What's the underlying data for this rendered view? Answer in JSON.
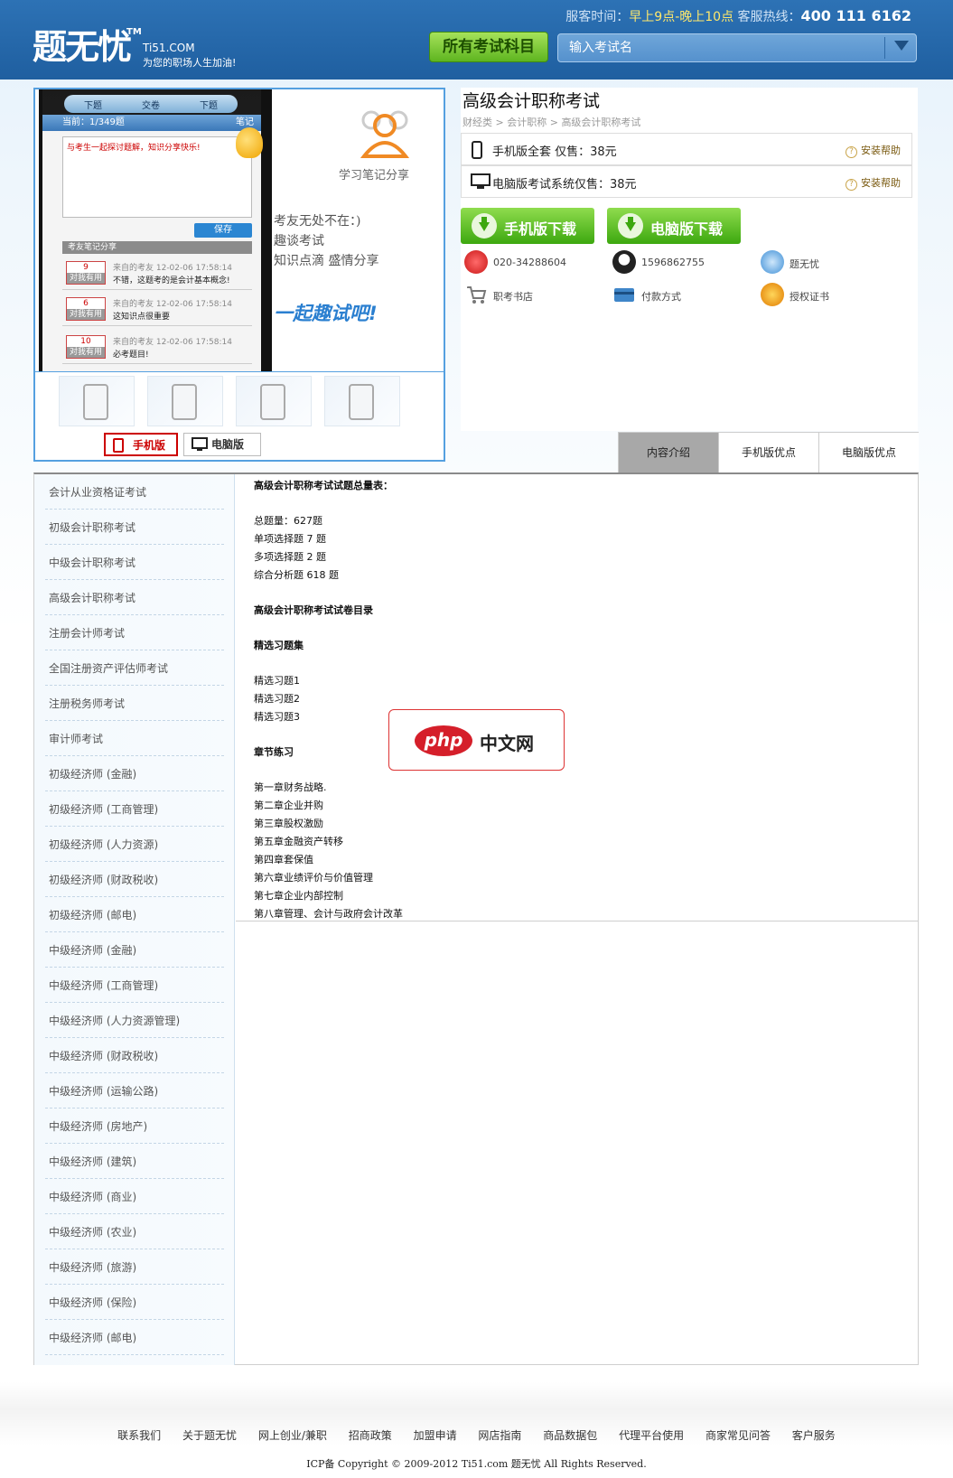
{
  "header": {
    "logo_text": "题无忧",
    "logo_tm": "TM",
    "domain": "Ti51.COM",
    "slogan": "为您的职场人生加油!",
    "service_label": "服客时间：",
    "service_hours": "早上9点-晚上10点",
    "hotline_label": "客服热线：",
    "hotline": "400 111 6162",
    "all_subjects_label": "所有考试科目",
    "search_placeholder": "输入考试名"
  },
  "gallery": {
    "phone_tabs": [
      "下题",
      "交卷",
      "下题"
    ],
    "progress": "当前：1/349题",
    "edit_label": "笔记",
    "textarea_text": "与考生一起探讨题解，知识分享快乐!",
    "save_label": "保存",
    "section_label": "考友笔记分享",
    "notes": [
      {
        "count": "9",
        "vote": "对我有用",
        "meta": "来自的考友 12-02-06 17:58:14",
        "text": "不错，这题考的是会计基本概念!"
      },
      {
        "count": "6",
        "vote": "对我有用",
        "meta": "来自的考友 12-02-06 17:58:14",
        "text": "这知识点很重要"
      },
      {
        "count": "10",
        "vote": "对我有用",
        "meta": "来自的考友 12-02-06 17:58:14",
        "text": "必考题目!"
      }
    ],
    "notes_title": "学习笔记分享",
    "side_lines": [
      "考友无处不在：)",
      "趣谈考试",
      "知识点滴 盛情分享"
    ],
    "side_slogan": "一起趣试吧!",
    "version_tabs": [
      "手机版",
      "电脑版"
    ]
  },
  "product": {
    "title": "高级会计职称考试",
    "breadcrumb": [
      "财经类",
      "会计职称",
      "高级会计职称考试"
    ],
    "breadcrumb_sep": ">",
    "price_mobile": "手机版全套  仅售：38元",
    "price_pc": "电脑版考试系统仅售：38元",
    "help_label": "安装帮助",
    "download_mobile": "手机版下载",
    "download_pc": "电脑版下载",
    "contacts": [
      {
        "label": "020-34288604",
        "icon": "phone-icon"
      },
      {
        "label": "1596862755",
        "icon": "qq-icon"
      },
      {
        "label": "题无忧",
        "icon": "chat-icon"
      },
      {
        "label": "职考书店",
        "icon": "cart-icon"
      },
      {
        "label": "付款方式",
        "icon": "card-icon"
      },
      {
        "label": "授权证书",
        "icon": "certificate-icon"
      }
    ]
  },
  "tabs": [
    "内容介绍",
    "手机版优点",
    "电脑版优点"
  ],
  "left_nav": [
    "会计从业资格证考试",
    "初级会计职称考试",
    "中级会计职称考试",
    "高级会计职称考试",
    "注册会计师考试",
    "全国注册资产评估师考试",
    "注册税务师考试",
    "审计师考试",
    "初级经济师 (金融)",
    "初级经济师 (工商管理)",
    "初级经济师 (人力资源)",
    "初级经济师 (财政税收)",
    "初级经济师 (邮电)",
    "中级经济师 (金融)",
    "中级经济师 (工商管理)",
    "中级经济师 (人力资源管理)",
    "中级经济师 (财政税收)",
    "中级经济师 (运输公路)",
    "中级经济师 (房地产)",
    "中级经济师 (建筑)",
    "中级经济师 (商业)",
    "中级经济师 (农业)",
    "中级经济师 (旅游)",
    "中级经济师 (保险)",
    "中级经济师 (邮电)"
  ],
  "content": {
    "summary_title": "高级会计职称考试试题总量表：",
    "totals": [
      "总题量：627题",
      "单项选择题 7 题",
      "多项选择题 2 题",
      "综合分析题 618 题"
    ],
    "catalog_title": "高级会计职称考试试卷目录",
    "practice_title": "精选习题集",
    "practice_items": [
      "精选习题1",
      "精选习题2",
      "精选习题3"
    ],
    "chapter_title": "章节练习",
    "chapters": [
      "第一章财务战略.",
      "第二章企业并购",
      "第三章股权激励",
      "第五章金融资产转移",
      "第四章套保值",
      "第六章业绩评价与价值管理",
      "第七章企业内部控制",
      "第八章管理、会计与政府会计改革"
    ]
  },
  "watermark": {
    "php": "php",
    "cn": "中文网"
  },
  "footer": {
    "links": [
      "联系我们",
      "关于题无忧",
      "网上创业/兼职",
      "招商政策",
      "加盟申请",
      "网店指南",
      "商品数据包",
      "代理平台使用",
      "商家常见问答",
      "客户服务"
    ],
    "copyright": "ICP备 Copyright © 2009-2012 Ti51.com 题无忧 All Rights Reserved."
  }
}
